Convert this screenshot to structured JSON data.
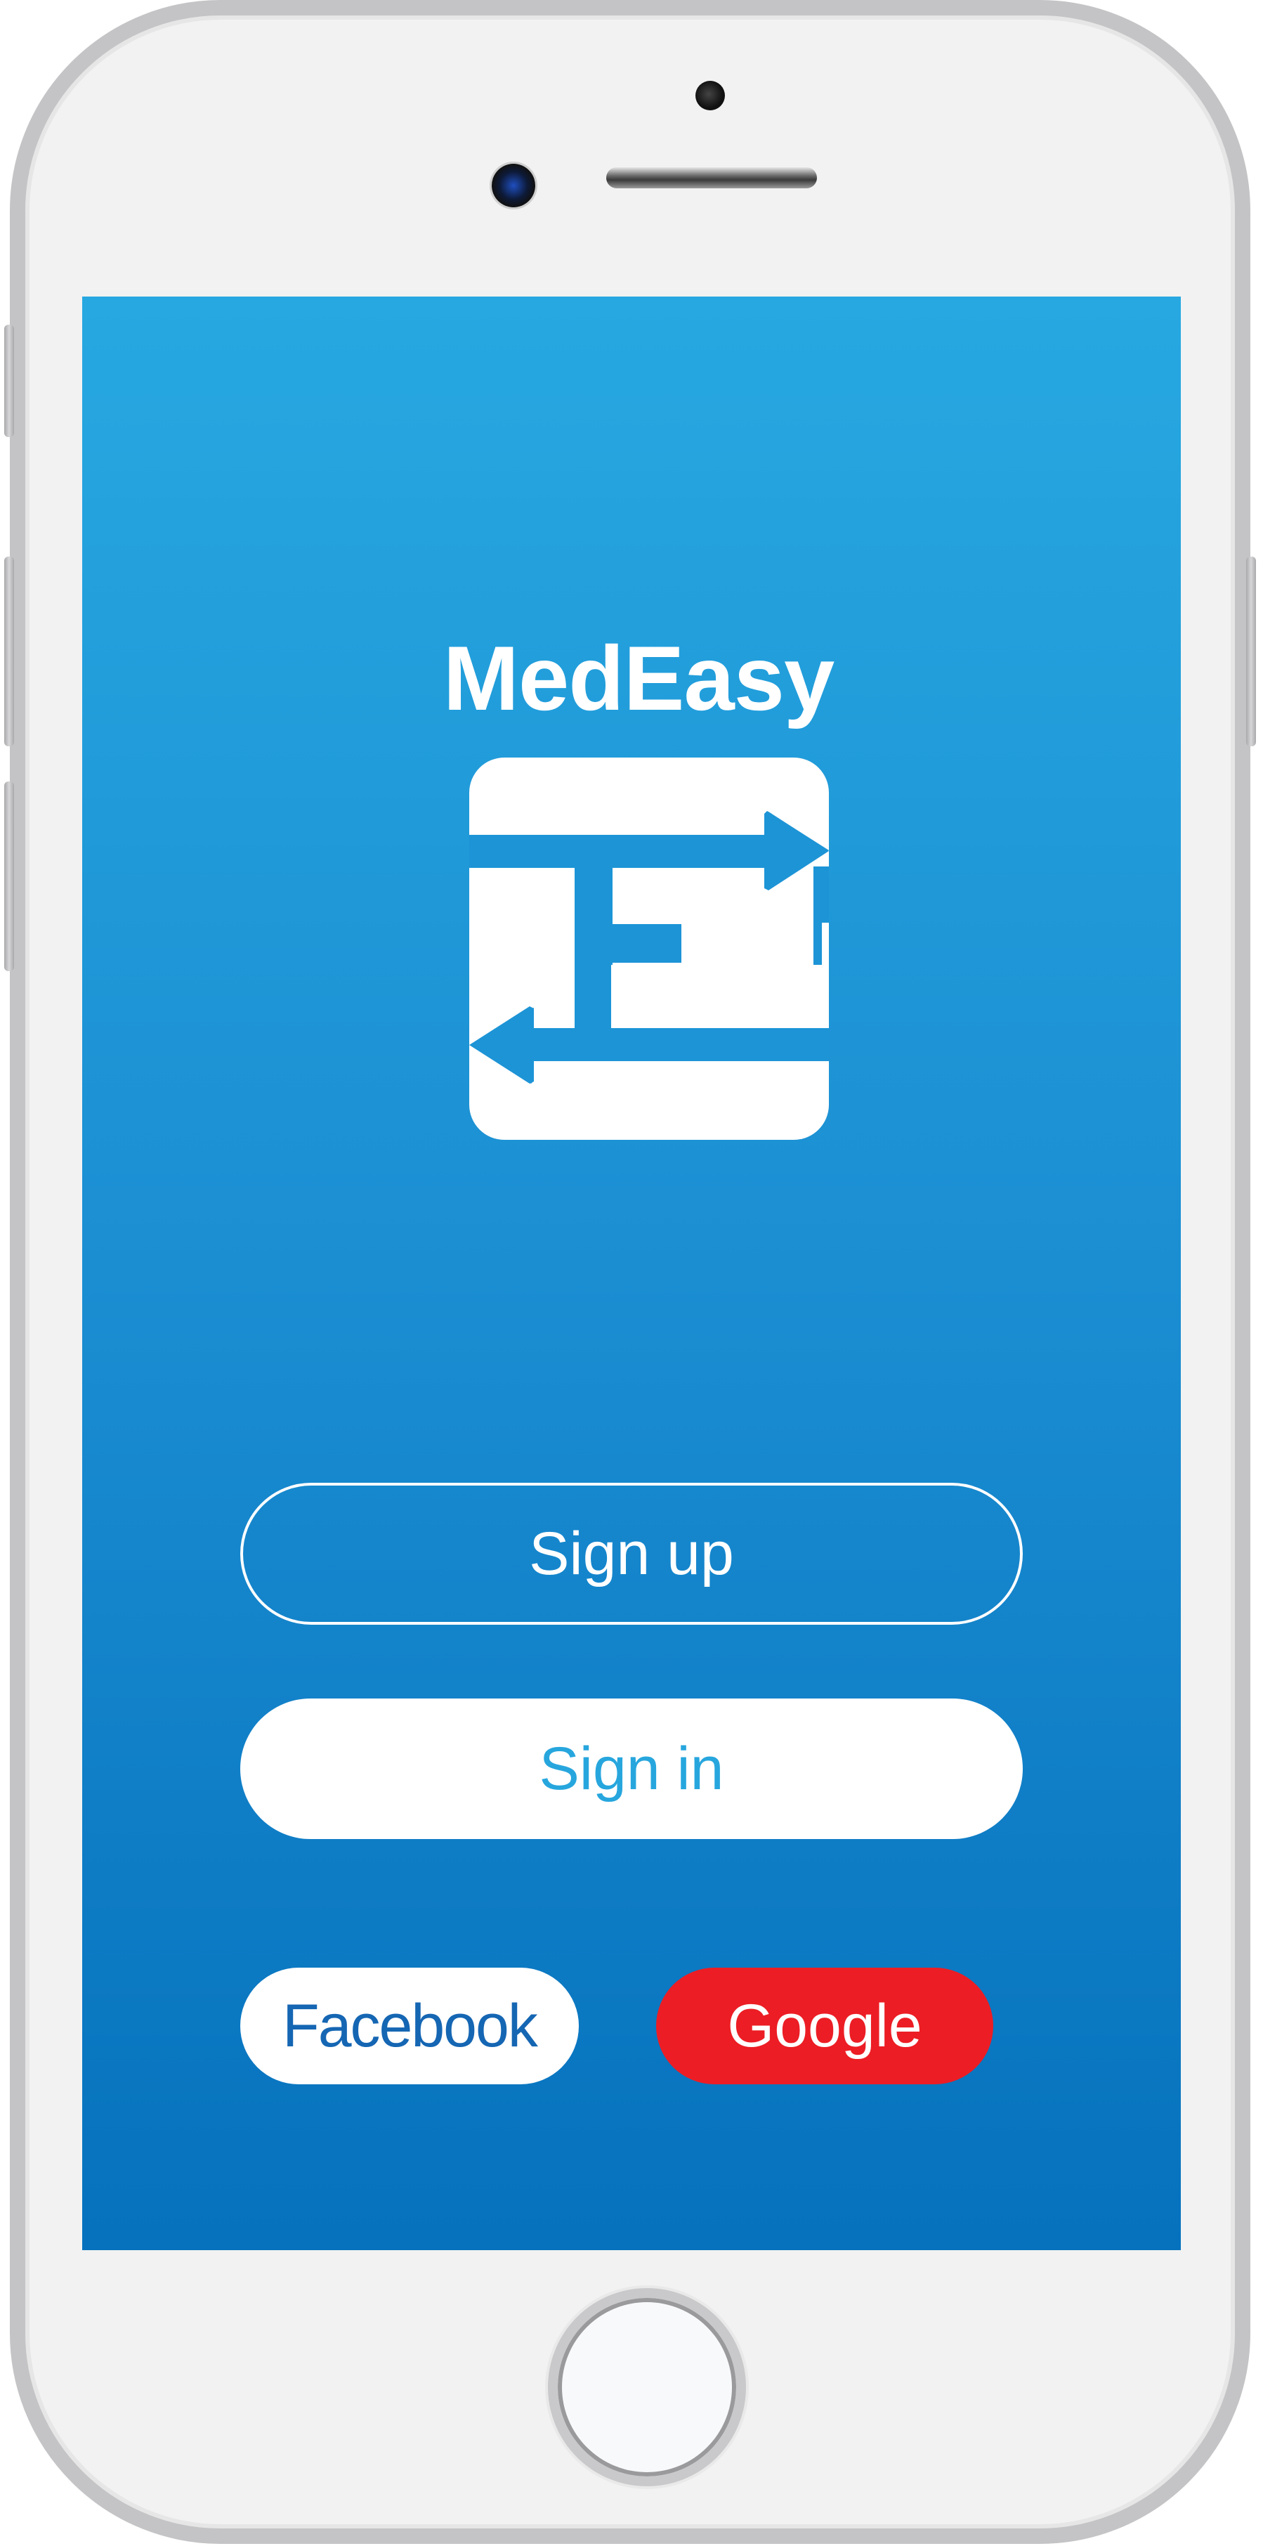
{
  "device": {
    "frame_color": "#c4c4c6",
    "body_color": "#f2f2f2"
  },
  "app": {
    "title": "MedEasy",
    "logo_icon": "medeasy-logo-icon",
    "screen_gradient": [
      "#27a8e1",
      "#0671bd"
    ]
  },
  "buttons": {
    "sign_up_label": "Sign up",
    "sign_in_label": "Sign in",
    "facebook_label": "Facebook",
    "google_label": "Google"
  },
  "colors": {
    "facebook_text": "#1566b3",
    "google_bg": "#ec1d24",
    "sign_in_text": "#27a6de"
  }
}
